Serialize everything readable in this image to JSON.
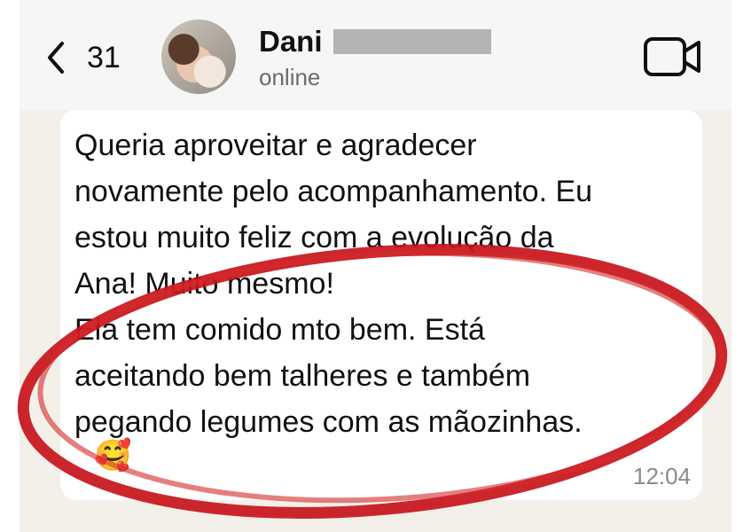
{
  "header": {
    "back_count": "31",
    "contact_name": "Dani",
    "contact_status": "online"
  },
  "message": {
    "text": "Queria aproveitar e agradecer\nnovamente pelo acompanhamento. Eu\nestou muito feliz com a evolução da\nAna! Muito mesmo!\nEla tem comido mto bem. Está\naceitando bem talheres e também\npegando legumes com as mãozinhas.",
    "emoji": "🥰",
    "time": "12:04"
  },
  "icons": {
    "back": "chevron-left-icon",
    "video": "video-camera-icon",
    "avatar": "contact-avatar"
  },
  "colors": {
    "highlight_oval": "#c8141b",
    "header_bg": "#f6f6f6",
    "chat_bg": "#f3f0ea",
    "bubble_bg": "#ffffff"
  }
}
